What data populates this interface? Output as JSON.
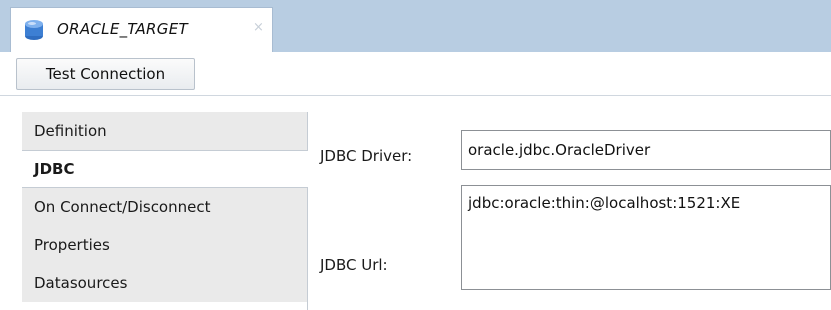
{
  "tab": {
    "title": "ORACLE_TARGET",
    "close_glyph": "×",
    "icon": "database-icon"
  },
  "toolbar": {
    "test_connection_label": "Test Connection"
  },
  "nav": {
    "items": [
      {
        "label": "Definition",
        "active": false
      },
      {
        "label": "JDBC",
        "active": true
      },
      {
        "label": "On Connect/Disconnect",
        "active": false
      },
      {
        "label": "Properties",
        "active": false
      },
      {
        "label": "Datasources",
        "active": false
      }
    ]
  },
  "form": {
    "driver_label": "JDBC Driver:",
    "driver_value": "oracle.jdbc.OracleDriver",
    "url_label": "JDBC Url:",
    "url_value": "jdbc:oracle:thin:@localhost:1521:XE"
  },
  "colors": {
    "tabbar_bg": "#b8cde2",
    "db_icon": "#3d7fd3",
    "nav_inactive_bg": "#eaeaea"
  }
}
